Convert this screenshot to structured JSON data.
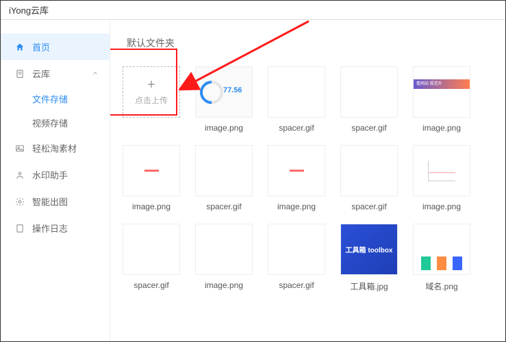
{
  "window": {
    "title": "iYong云库"
  },
  "sidebar": {
    "items": [
      {
        "label": "首页"
      },
      {
        "label": "云库"
      },
      {
        "label": "轻松淘素材"
      },
      {
        "label": "水印助手"
      },
      {
        "label": "智能出图"
      },
      {
        "label": "操作日志"
      }
    ],
    "cloud_sub": [
      {
        "label": "文件存储"
      },
      {
        "label": "视频存储"
      }
    ]
  },
  "main": {
    "folder_title": "默认文件夹",
    "upload_label": "点击上传",
    "donut_value": "77.56",
    "toolbox_label": "工具箱 toolbox",
    "purple_text": "看网站 规范升",
    "files": {
      "r1": [
        "image.png",
        "spacer.gif",
        "spacer.gif",
        "image.png"
      ],
      "r2": [
        "image.png",
        "spacer.gif",
        "image.png",
        "spacer.gif",
        "image.png"
      ],
      "r3": [
        "spacer.gif",
        "image.png",
        "spacer.gif",
        "工具箱.jpg",
        "域名.png"
      ]
    }
  }
}
